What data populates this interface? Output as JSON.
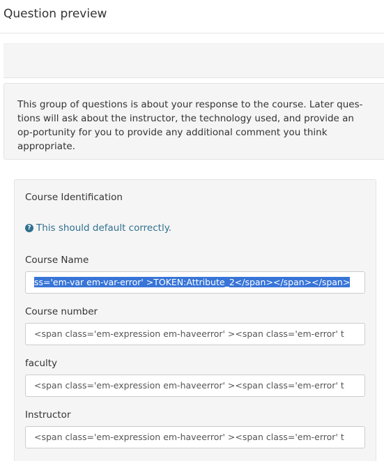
{
  "header": {
    "title": "Question preview"
  },
  "description": {
    "text": "This group of questions is about your response to the course. Later ques-tions will ask about the instructor, the technology used, and provide an op-portunity for you to provide any additional comment you think appropriate."
  },
  "group": {
    "title": "Course Identification",
    "help_text": "This should default correctly.",
    "help_icon": "question-circle-icon",
    "fields": [
      {
        "label": "Course Name",
        "value": "ss='em-var em-var-error' >TOKEN:Attribute_2</span></span></span>"
      },
      {
        "label": "Course number",
        "value": "<span class='em-expression em-haveerror'  ><span class='em-error' t"
      },
      {
        "label": "faculty",
        "value": "<span class='em-expression em-haveerror'  ><span class='em-error' t"
      },
      {
        "label": "Instructor",
        "value": "<span class='em-expression em-haveerror'  ><span class='em-error' t"
      }
    ]
  },
  "colors": {
    "help_text": "#31708f",
    "selection": "#3875d7",
    "panel_bg": "#f5f5f5"
  }
}
